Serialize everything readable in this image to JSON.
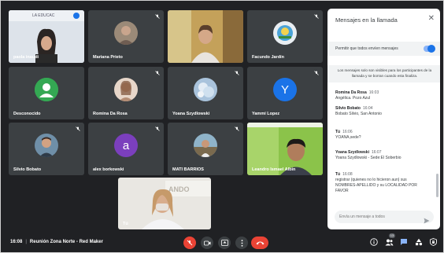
{
  "participants": [
    {
      "name": "paola inaudi",
      "kind": "video"
    },
    {
      "name": "Mariana Prieto",
      "kind": "photo"
    },
    {
      "name": "",
      "kind": "video"
    },
    {
      "name": "Facundo Jardín",
      "kind": "photo"
    },
    {
      "name": "Desconocido",
      "kind": "default"
    },
    {
      "name": "Romina Da Rosa",
      "kind": "photo"
    },
    {
      "name": "Yoana Szydlowski",
      "kind": "photo"
    },
    {
      "name": "Yammi Lopez",
      "kind": "letter",
      "letter": "Y",
      "color": "#1a73e8"
    },
    {
      "name": "Silvio Bobato",
      "kind": "photo"
    },
    {
      "name": "alex borkowski",
      "kind": "letter",
      "letter": "a",
      "color": "#7b3fbd"
    },
    {
      "name": "MATI BARRIOS",
      "kind": "photo"
    },
    {
      "name": "Leandro Ismael Albin",
      "kind": "video"
    },
    {
      "name": "Tú",
      "kind": "video"
    }
  ],
  "chat": {
    "title": "Mensajes en la llamada",
    "toggle_label": "Permitir que todos envíen mensajes",
    "toggle_on": true,
    "notice": "Los mensajes solo son visibles para los participantes de la llamada y se borran cuando esta finaliza.",
    "messages": [
      {
        "sender": "Romina Da Rosa",
        "time": "16:03",
        "text": "Angélica. Pozo Azul"
      },
      {
        "sender": "Silvio Bobato",
        "time": "16:04",
        "text": "Bobato Silvio, San Antonio"
      },
      {
        "sender": "Tú",
        "time": "16:06",
        "text": "YOANA,sede?"
      },
      {
        "sender": "Yoana Szydlowski",
        "time": "16:07",
        "text": "Yoana Szydlowski - Sede:El Soberbio"
      },
      {
        "sender": "Tú",
        "time": "16:08",
        "text": "registrar (quienes no lo hicieron aun) sus NOMBRES-APELLIDO y su LOCALIDAD POR FAVOR"
      }
    ],
    "input_placeholder": "Envía un mensaje a todos"
  },
  "bottom": {
    "time": "16:08",
    "meeting_name": "Reunión Zona Norte - Red Maker",
    "participant_count": "13"
  },
  "colors": {
    "background": "#202124",
    "tile": "#3c4043",
    "end_call": "#ea4335",
    "accent": "#1a73e8"
  }
}
